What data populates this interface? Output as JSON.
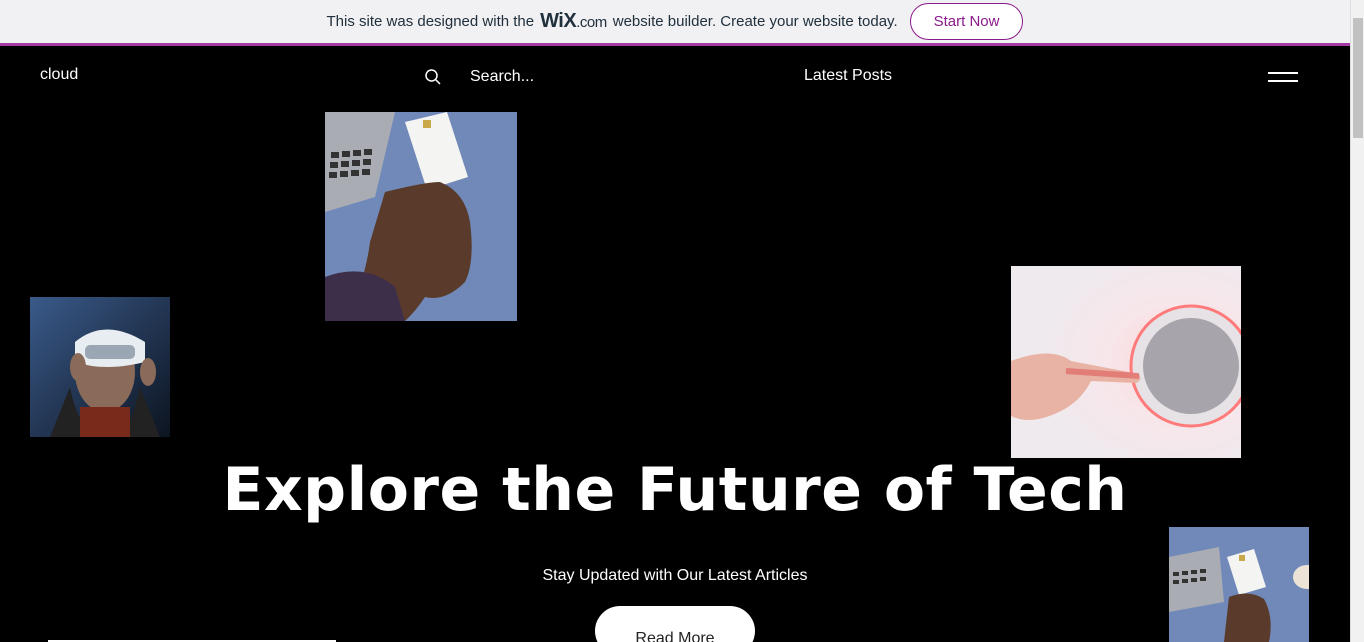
{
  "banner": {
    "text_before": "This site was designed with the",
    "wix_brand": "WiX",
    "wix_domain": ".com",
    "text_after": "website builder. Create your website today.",
    "cta_label": "Start Now",
    "accent_color": "#a43aa6"
  },
  "header": {
    "logo": "cloud",
    "search_placeholder": "Search...",
    "nav_latest": "Latest Posts"
  },
  "hero": {
    "title": "Explore the Future of Tech",
    "subtitle": "Stay Updated with Our Latest Articles",
    "button_label": "Read More"
  },
  "icons": {
    "search": "search-icon",
    "menu": "hamburger-menu-icon"
  }
}
